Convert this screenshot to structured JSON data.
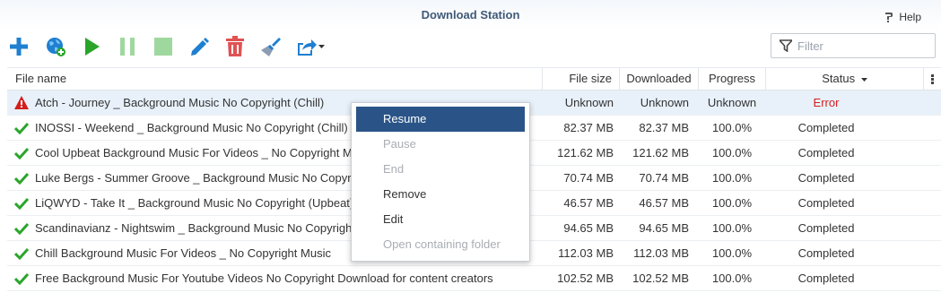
{
  "app": {
    "title": "Download Station",
    "help_label": "Help"
  },
  "toolbar": {
    "buttons": [
      {
        "icon": "plus-icon",
        "color": "#1f7fd0"
      },
      {
        "icon": "globe-add-icon",
        "color": "#1f7fd0"
      },
      {
        "icon": "play-icon",
        "color": "#2aa52a"
      },
      {
        "icon": "pause-icon",
        "color": "#9fd89f"
      },
      {
        "icon": "stop-icon",
        "color": "#9fd89f"
      },
      {
        "icon": "pencil-icon",
        "color": "#1f7fd0"
      },
      {
        "icon": "trash-icon",
        "color": "#e05252"
      },
      {
        "icon": "broom-icon",
        "color": "#1f7fd0"
      },
      {
        "icon": "share-icon",
        "color": "#1f7fd0"
      }
    ],
    "filter_placeholder": "Filter"
  },
  "table": {
    "columns": {
      "name": "File name",
      "size": "File size",
      "downloaded": "Downloaded",
      "progress": "Progress",
      "status": "Status"
    },
    "rows": [
      {
        "name": "Atch - Journey _ Background Music No Copyright (Chill)",
        "size": "Unknown",
        "downloaded": "Unknown",
        "progress": "Unknown",
        "status": "Error",
        "state": "error"
      },
      {
        "name": "INOSSI - Weekend _ Background Music No Copyright (Chill)",
        "size": "82.37 MB",
        "downloaded": "82.37 MB",
        "progress": "100.0%",
        "status": "Completed",
        "state": "ok"
      },
      {
        "name": "Cool Upbeat Background Music For Videos _ No Copyright Music",
        "size": "121.62 MB",
        "downloaded": "121.62 MB",
        "progress": "100.0%",
        "status": "Completed",
        "state": "ok"
      },
      {
        "name": "Luke Bergs - Summer Groove _ Background Music No Copyright",
        "size": "70.74 MB",
        "downloaded": "70.74 MB",
        "progress": "100.0%",
        "status": "Completed",
        "state": "ok"
      },
      {
        "name": "LiQWYD - Take It _ Background Music No Copyright (Upbeat)",
        "size": "46.57 MB",
        "downloaded": "46.57 MB",
        "progress": "100.0%",
        "status": "Completed",
        "state": "ok"
      },
      {
        "name": "Scandinavianz - Nightswim _ Background Music No Copyright",
        "size": "94.65 MB",
        "downloaded": "94.65 MB",
        "progress": "100.0%",
        "status": "Completed",
        "state": "ok"
      },
      {
        "name": "Chill Background Music For Videos _ No Copyright Music",
        "size": "112.03 MB",
        "downloaded": "112.03 MB",
        "progress": "100.0%",
        "status": "Completed",
        "state": "ok"
      },
      {
        "name": "Free Background Music For Youtube Videos No Copyright Download for content creators",
        "size": "102.52 MB",
        "downloaded": "102.52 MB",
        "progress": "100.0%",
        "status": "Completed",
        "state": "ok"
      }
    ]
  },
  "context_menu": {
    "items": [
      {
        "label": "Resume",
        "state": "active"
      },
      {
        "label": "Pause",
        "state": "disabled"
      },
      {
        "label": "End",
        "state": "disabled"
      },
      {
        "label": "Remove",
        "state": "enabled"
      },
      {
        "label": "Edit",
        "state": "enabled"
      },
      {
        "label": "Open containing folder",
        "state": "disabled"
      }
    ]
  },
  "colors": {
    "accent": "#2a5488",
    "title": "#3f5a78",
    "error": "#d21e1e",
    "success": "#2aa52a",
    "selected_row": "#e8f1fa"
  }
}
